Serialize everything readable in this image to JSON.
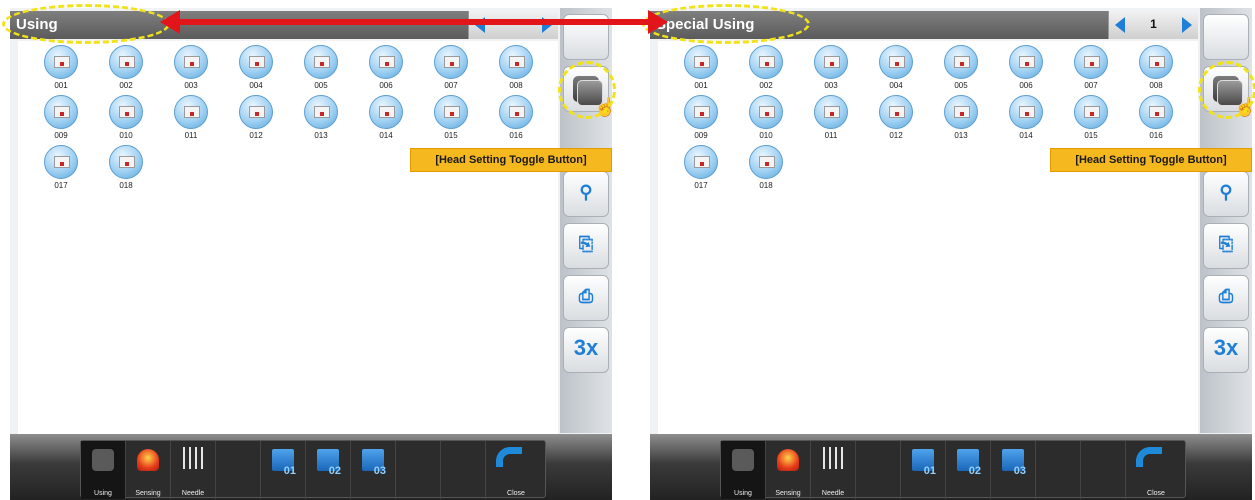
{
  "panels": [
    {
      "title": "Using",
      "page_number": "",
      "heads": [
        "001",
        "002",
        "003",
        "004",
        "005",
        "006",
        "007",
        "008",
        "009",
        "010",
        "011",
        "012",
        "013",
        "014",
        "015",
        "016",
        "017",
        "018"
      ],
      "callout": "[Head Setting Toggle Button]",
      "toolbar": {
        "using": "Using",
        "sensing": "Sensing",
        "needle": "Needle",
        "folder1": "01",
        "folder2": "02",
        "folder3": "03",
        "close": "Close"
      },
      "sidebar_3x": "3x"
    },
    {
      "title": "Special Using",
      "page_number": "1",
      "heads": [
        "001",
        "002",
        "003",
        "004",
        "005",
        "006",
        "007",
        "008",
        "009",
        "010",
        "011",
        "012",
        "013",
        "014",
        "015",
        "016",
        "017",
        "018"
      ],
      "callout": "[Head Setting Toggle Button]",
      "toolbar": {
        "using": "Using",
        "sensing": "Sensing",
        "needle": "Needle",
        "folder1": "01",
        "folder2": "02",
        "folder3": "03",
        "close": "Close"
      },
      "sidebar_3x": "3x"
    }
  ],
  "colors": {
    "accent_blue": "#1f7fd6",
    "highlight_yellow": "#f2e21a",
    "callout_orange": "#f5b81e",
    "arrow_red": "#e1151a"
  }
}
